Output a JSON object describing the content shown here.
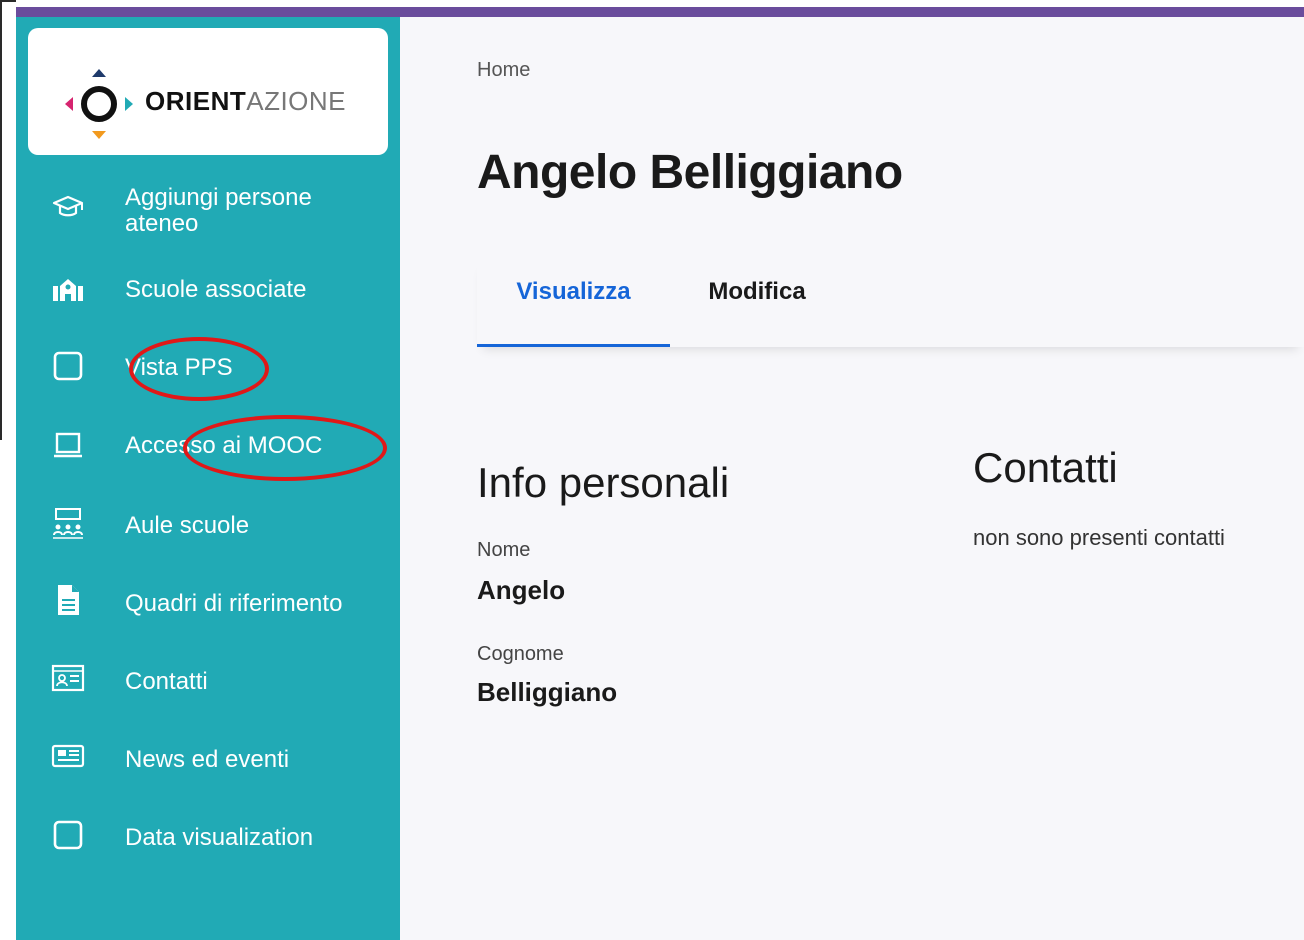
{
  "sidebar": {
    "logo": {
      "text_bold": "ORIENT",
      "text_light": "AZIONE"
    },
    "items": [
      {
        "label": "Aggiungi persone ateneo",
        "icon": "graduation-cap-icon"
      },
      {
        "label": "Scuole associate",
        "icon": "school-building-icon"
      },
      {
        "label": "Vista PPS",
        "icon": "square-icon"
      },
      {
        "label": "Accesso ai MOOC",
        "icon": "laptop-icon"
      },
      {
        "label": "Aule scuole",
        "icon": "classroom-icon"
      },
      {
        "label": "Quadri di riferimento",
        "icon": "document-icon"
      },
      {
        "label": "Contatti",
        "icon": "contact-card-icon"
      },
      {
        "label": "News ed eventi",
        "icon": "newspaper-icon"
      },
      {
        "label": "Data visualization",
        "icon": "square-icon"
      }
    ]
  },
  "breadcrumb": "Home",
  "page_title": "Angelo Belliggiano",
  "tabs": [
    {
      "label": "Visualizza",
      "active": true
    },
    {
      "label": "Modifica",
      "active": false
    }
  ],
  "info": {
    "title": "Info personali",
    "nome_label": "Nome",
    "nome_value": "Angelo",
    "cognome_label": "Cognome",
    "cognome_value": "Belliggiano"
  },
  "contatti": {
    "title": "Contatti",
    "empty_text": "non sono presenti contatti"
  },
  "colors": {
    "sidebar": "#21aab5",
    "topbar": "#6a4c9c",
    "tab_active": "#1565d8",
    "annotation": "#e01818"
  }
}
